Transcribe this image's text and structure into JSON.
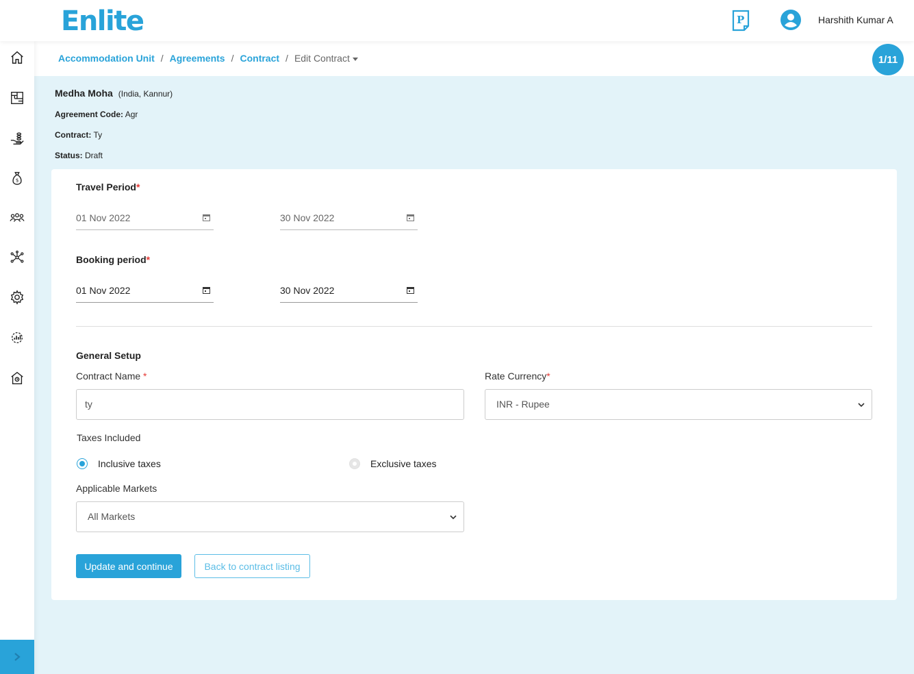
{
  "app": {
    "logo": "Enlite",
    "user_name": "Harshith Kumar A"
  },
  "breadcrumb": {
    "items": [
      "Accommodation Unit",
      "Agreements",
      "Contract"
    ],
    "separator": "/",
    "current": "Edit Contract"
  },
  "counter": "1/11",
  "header_info": {
    "name": "Medha Moha",
    "location": "(India, Kannur)",
    "agreement_code_label": "Agreement Code:",
    "agreement_code": "Agr",
    "contract_label": "Contract:",
    "contract": "Ty",
    "status_label": "Status:",
    "status": "Draft"
  },
  "travel_period": {
    "label": "Travel Period",
    "required_mark": "*",
    "start": "01 Nov 2022",
    "end": "30 Nov 2022"
  },
  "booking_period": {
    "label": "Booking period",
    "required_mark": "*",
    "start": "01 Nov 2022",
    "end": "30 Nov 2022"
  },
  "general_setup": {
    "title": "General Setup",
    "contract_name_label": "Contract Name",
    "contract_name_value": "ty",
    "rate_currency_label": "Rate Currency",
    "rate_currency_value": "INR - Rupee",
    "taxes_label": "Taxes Included",
    "tax_options": [
      "Inclusive taxes",
      "Exclusive taxes"
    ],
    "tax_selected": "Inclusive taxes",
    "markets_label": "Applicable Markets",
    "markets_value": "All Markets",
    "required_mark": "*"
  },
  "buttons": {
    "update": "Update and continue",
    "back": "Back to contract listing"
  },
  "colors": {
    "accent": "#29a3d9",
    "background": "#e3f3f9",
    "required": "#e53935"
  },
  "sidebar": {
    "icons": [
      "home-icon",
      "floor-plan-icon",
      "hand-coins-icon",
      "money-bag-icon",
      "users-icon",
      "network-icon",
      "gear-icon",
      "analytics-icon",
      "building-icon"
    ],
    "toggle_icon": "chevron-right-icon"
  }
}
